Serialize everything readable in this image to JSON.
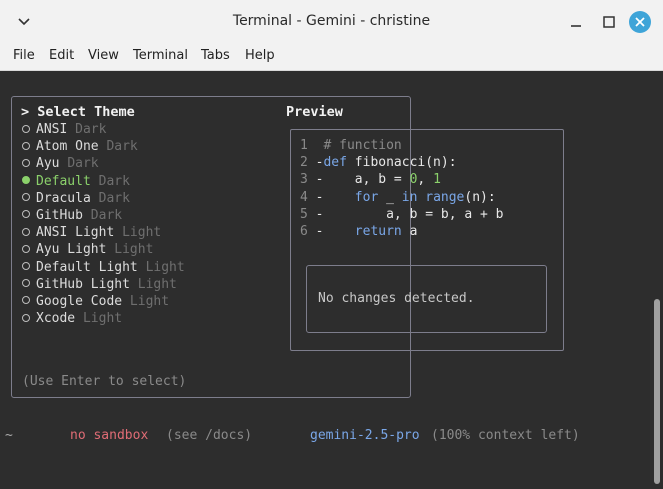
{
  "window": {
    "title": "Terminal -  Gemini - christine",
    "accent_close": "#3ea4d8"
  },
  "menu": [
    "File",
    "Edit",
    "View",
    "Terminal",
    "Tabs",
    "Help"
  ],
  "theme_dialog": {
    "title": "> Select Theme",
    "preview_title": "Preview",
    "themes": [
      {
        "name": "ANSI",
        "type": "Dark",
        "selected": false
      },
      {
        "name": "Atom One",
        "type": "Dark",
        "selected": false
      },
      {
        "name": "Ayu",
        "type": "Dark",
        "selected": false
      },
      {
        "name": "Default",
        "type": "Dark",
        "selected": true
      },
      {
        "name": "Dracula",
        "type": "Dark",
        "selected": false
      },
      {
        "name": "GitHub",
        "type": "Dark",
        "selected": false
      },
      {
        "name": "ANSI Light",
        "type": "Light",
        "selected": false
      },
      {
        "name": "Ayu Light",
        "type": "Light",
        "selected": false
      },
      {
        "name": "Default Light",
        "type": "Light",
        "selected": false
      },
      {
        "name": "GitHub Light",
        "type": "Light",
        "selected": false
      },
      {
        "name": "Google Code",
        "type": "Light",
        "selected": false
      },
      {
        "name": "Xcode",
        "type": "Light",
        "selected": false
      }
    ],
    "hint": "(Use Enter to select)",
    "code": [
      {
        "n": "1",
        "prefix": " ",
        "tokens": [
          {
            "t": "comment",
            "v": "# function"
          }
        ]
      },
      {
        "n": "2",
        "prefix": "-",
        "tokens": [
          {
            "t": "kw",
            "v": "def"
          },
          {
            "t": "plain",
            "v": " fibonacci(n):"
          }
        ]
      },
      {
        "n": "3",
        "prefix": "-",
        "tokens": [
          {
            "t": "plain",
            "v": "    a, b = "
          },
          {
            "t": "num",
            "v": "0"
          },
          {
            "t": "plain",
            "v": ", "
          },
          {
            "t": "num",
            "v": "1"
          }
        ]
      },
      {
        "n": "4",
        "prefix": "-",
        "tokens": [
          {
            "t": "plain",
            "v": "    "
          },
          {
            "t": "kw",
            "v": "for"
          },
          {
            "t": "plain",
            "v": " _ "
          },
          {
            "t": "kw",
            "v": "in"
          },
          {
            "t": "plain",
            "v": " "
          },
          {
            "t": "builtin",
            "v": "range"
          },
          {
            "t": "plain",
            "v": "(n):"
          }
        ]
      },
      {
        "n": "5",
        "prefix": "-",
        "tokens": [
          {
            "t": "plain",
            "v": "        a, b = b, a + b"
          }
        ]
      },
      {
        "n": "6",
        "prefix": "-",
        "tokens": [
          {
            "t": "plain",
            "v": "    "
          },
          {
            "t": "kw",
            "v": "return"
          },
          {
            "t": "plain",
            "v": " a"
          }
        ]
      }
    ],
    "diff_message": "No changes detected."
  },
  "footer": {
    "home": "~",
    "sandbox": "no sandbox",
    "sandbox_hint": "(see /docs)",
    "model": "gemini-2.5-pro",
    "context": "(100% context left)"
  }
}
